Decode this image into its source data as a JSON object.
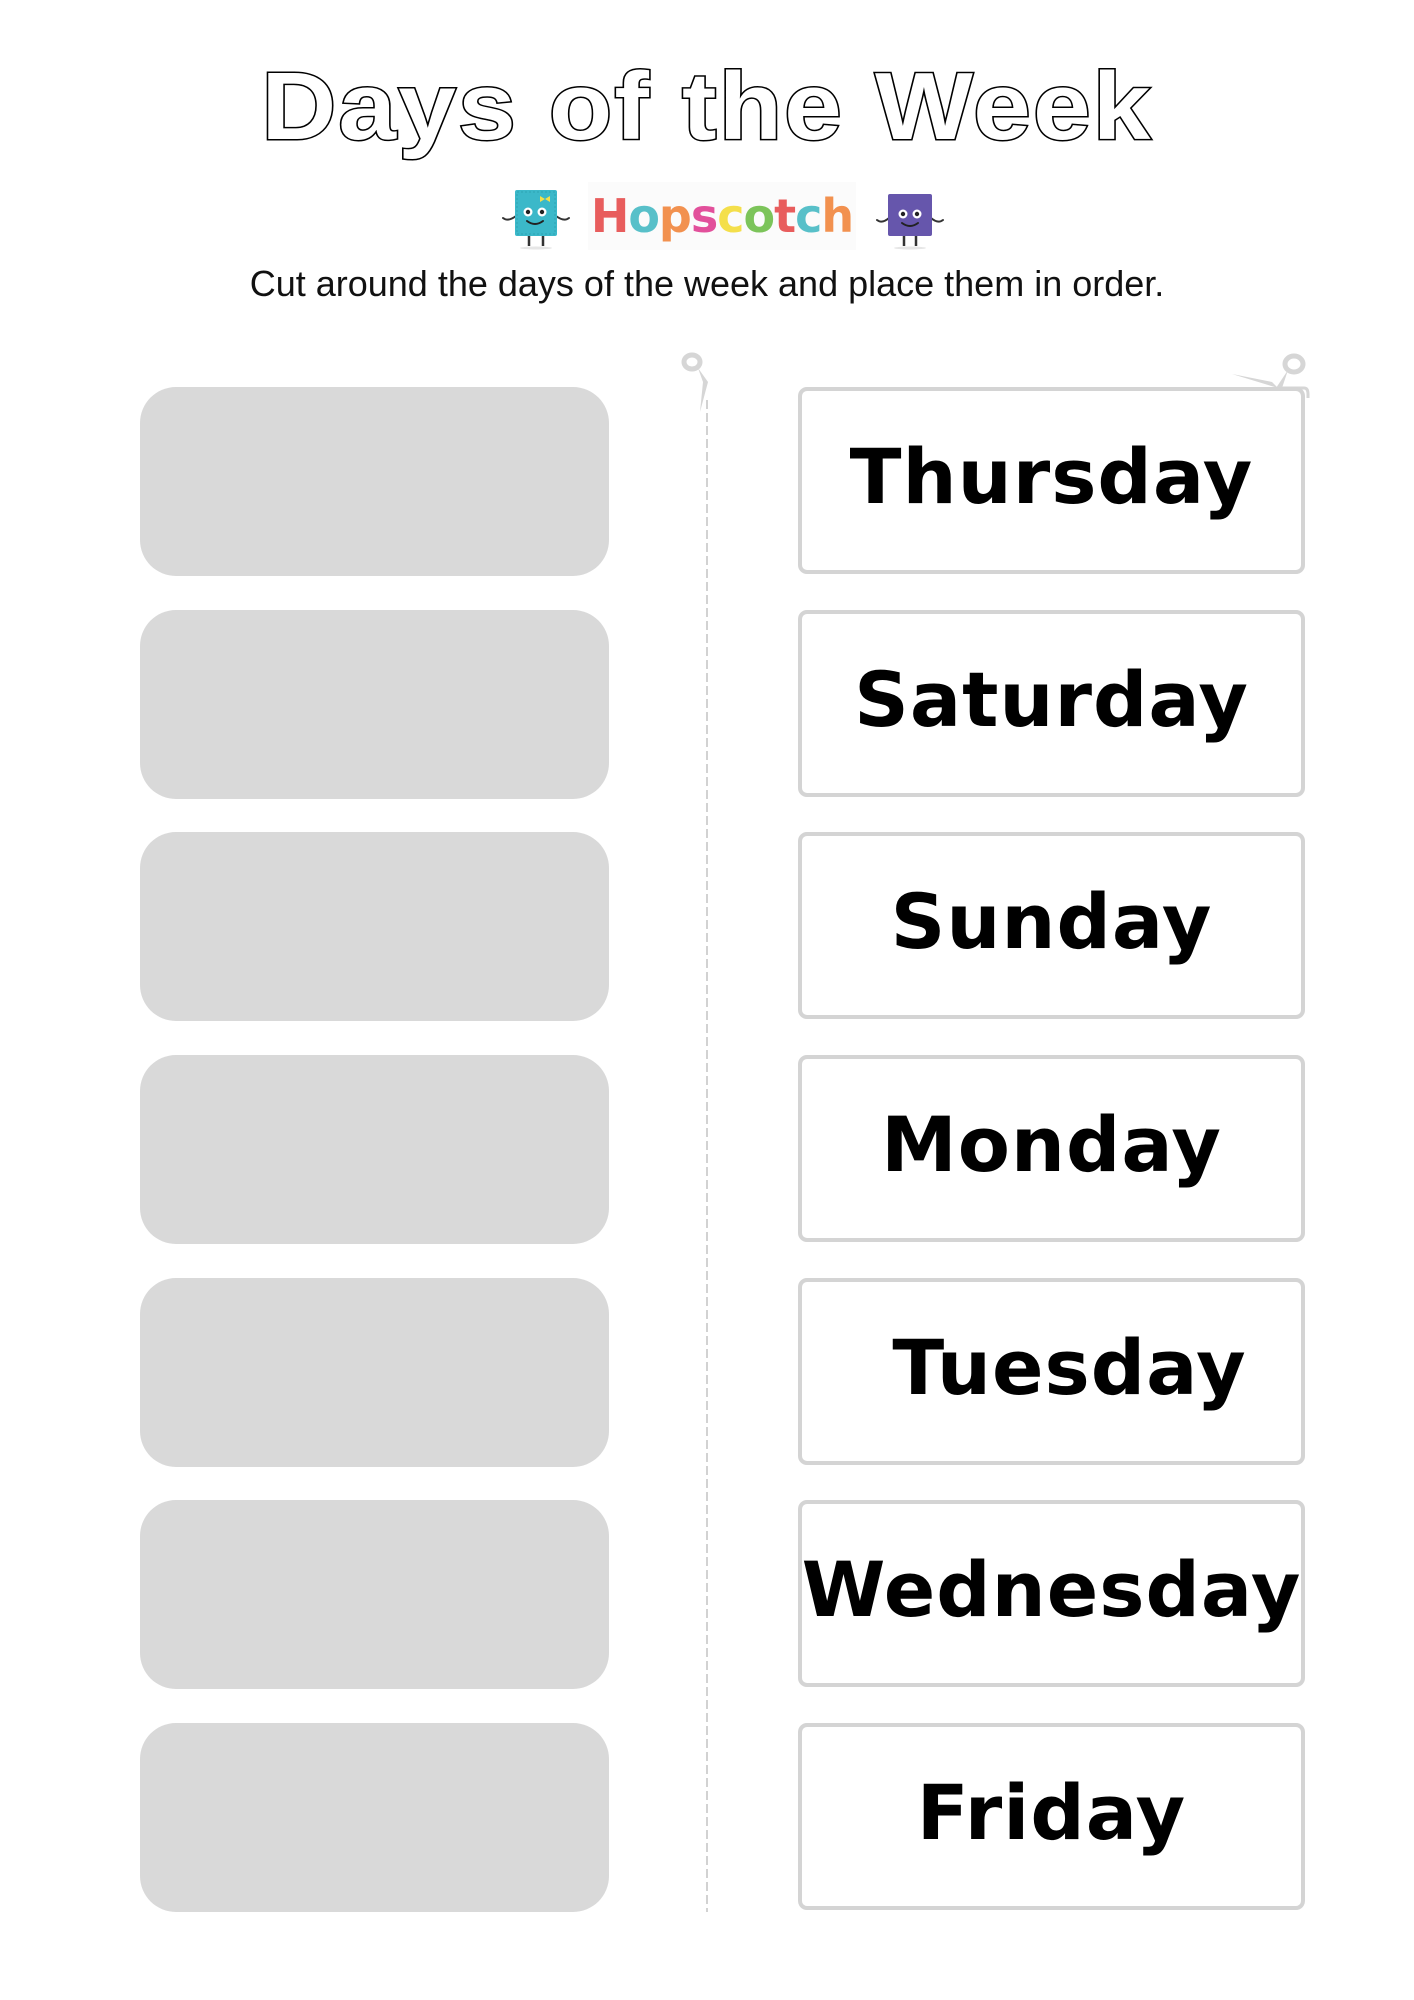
{
  "header": {
    "title": "Days of the Week",
    "brand": {
      "name": "Hopscotch",
      "letters": [
        {
          "char": "H",
          "color": "#e85d5d"
        },
        {
          "char": "o",
          "color": "#58c0c9"
        },
        {
          "char": "p",
          "color": "#f2914f"
        },
        {
          "char": "s",
          "color": "#e2509b"
        },
        {
          "char": "c",
          "color": "#f4df4b"
        },
        {
          "char": "o",
          "color": "#7cc45a"
        },
        {
          "char": "t",
          "color": "#e85d5d"
        },
        {
          "char": "c",
          "color": "#58c0c9"
        },
        {
          "char": "h",
          "color": "#f2914f"
        }
      ],
      "mascots": [
        {
          "name": "teal-mascot",
          "color": "#3bb8c9",
          "accessory": "yellow-bow"
        },
        {
          "name": "purple-mascot",
          "color": "#6656ac"
        }
      ]
    },
    "instructions": "Cut around the days of the week and place them in order."
  },
  "worksheet": {
    "slot_color": "#d9d9d9",
    "card_border_color": "#d4d4d4",
    "cut_line_color": "#d2d2d2",
    "answer_slots": [
      {
        "value": ""
      },
      {
        "value": ""
      },
      {
        "value": ""
      },
      {
        "value": ""
      },
      {
        "value": ""
      },
      {
        "value": ""
      },
      {
        "value": ""
      }
    ],
    "day_cards": [
      {
        "label": "Thursday"
      },
      {
        "label": "Saturday"
      },
      {
        "label": "Sunday"
      },
      {
        "label": "Monday"
      },
      {
        "label": "Tuesday"
      },
      {
        "label": "Wednesday"
      },
      {
        "label": "Friday"
      }
    ]
  }
}
